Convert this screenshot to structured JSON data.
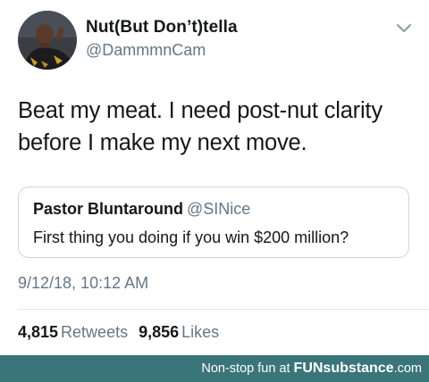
{
  "header": {
    "display_name": "Nut(But Don’t)tella",
    "handle": "@DammmnCam",
    "avatar_icon": "user-avatar",
    "menu_icon": "chevron-down-icon"
  },
  "tweet": {
    "text": "Beat my meat. I need post-nut clarity before I make my next move."
  },
  "quoted_tweet": {
    "display_name": "Pastor Bluntaround",
    "handle": "@SINice",
    "text": "First thing you doing if you win $200 million?"
  },
  "timestamp": "9/12/18, 10:12 AM",
  "stats": {
    "retweets_count": "4,815",
    "retweets_label": "Retweets",
    "likes_count": "9,856",
    "likes_label": "Likes"
  },
  "footer": {
    "prefix": "Non-stop fun at ",
    "brand": "FUNsubstance",
    "domain": ".com",
    "background_color": "#3a7579"
  },
  "colors": {
    "text_primary": "#14171a",
    "text_secondary": "#657786",
    "border": "#ccd6dd"
  }
}
